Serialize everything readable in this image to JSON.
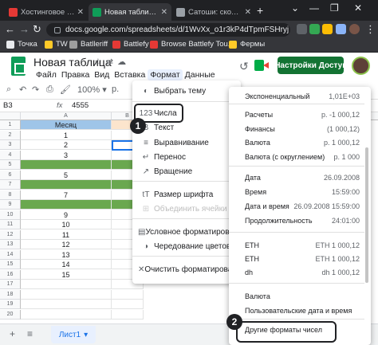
{
  "browser": {
    "tabs": [
      {
        "title": "Хостинговое сообщество",
        "favicon_color": "#e53935"
      },
      {
        "title": "Новая таблица - Google Таблицы",
        "favicon_color": "#0f9d58"
      },
      {
        "title": "Сатоши: сколько Сатоши",
        "favicon_color": "#9aa0a6"
      }
    ],
    "url": "docs.google.com/spreadsheets/d/1WvXx_o1r3kP4dTpmFSHryj",
    "bookmarks": [
      {
        "label": "Точка",
        "color": "#e8eaed"
      },
      {
        "label": "TW",
        "color": "#ffca28"
      },
      {
        "label": "Batlleriff",
        "color": "#9e9e9e"
      },
      {
        "label": "Battlefy",
        "color": "#e53935"
      },
      {
        "label": "Browse Battlefy Tou...",
        "color": "#e53935"
      },
      {
        "label": "Фермы",
        "color": "#ffca28"
      }
    ]
  },
  "sheet": {
    "title": "Новая таблица",
    "menu": [
      "Файл",
      "Правка",
      "Вид",
      "Вставка",
      "Формат",
      "Данные"
    ],
    "share_label": "Настройки Доступа",
    "cell_ref": "B3",
    "fx": "fx",
    "formula_value": "4555",
    "columns": [
      "A",
      "B"
    ],
    "header_cell": "Месяц",
    "rows": [
      {
        "num": "1",
        "a": "Месяц",
        "style": "hdr"
      },
      {
        "num": "2",
        "a": "1",
        "style": ""
      },
      {
        "num": "3",
        "a": "2",
        "style": ""
      },
      {
        "num": "4",
        "a": "3",
        "style": ""
      },
      {
        "num": "5",
        "a": "",
        "style": "green"
      },
      {
        "num": "6",
        "a": "5",
        "style": ""
      },
      {
        "num": "7",
        "a": "",
        "style": "green"
      },
      {
        "num": "8",
        "a": "7",
        "style": ""
      },
      {
        "num": "9",
        "a": "",
        "style": "green"
      },
      {
        "num": "10",
        "a": "9",
        "style": ""
      },
      {
        "num": "11",
        "a": "10",
        "style": ""
      },
      {
        "num": "12",
        "a": "11",
        "style": ""
      },
      {
        "num": "13",
        "a": "12",
        "style": ""
      },
      {
        "num": "14",
        "a": "13",
        "style": ""
      },
      {
        "num": "15",
        "a": "14",
        "style": ""
      },
      {
        "num": "16",
        "a": "15",
        "style": ""
      },
      {
        "num": "17",
        "a": "",
        "style": ""
      },
      {
        "num": "18",
        "a": "",
        "style": ""
      },
      {
        "num": "19",
        "a": "",
        "style": ""
      },
      {
        "num": "20",
        "a": "",
        "style": ""
      }
    ],
    "sheet_tab": "Лист1"
  },
  "format_menu": {
    "items": [
      {
        "label": "Выбрать тему",
        "icon": "◐",
        "disabled": false
      },
      {
        "label": "Числа",
        "icon": "123",
        "disabled": false
      },
      {
        "label": "Текст",
        "icon": "B",
        "disabled": false
      },
      {
        "label": "Выравнивание",
        "icon": "≡",
        "disabled": false
      },
      {
        "label": "Перенос",
        "icon": "↵",
        "disabled": false
      },
      {
        "label": "Вращение",
        "icon": "↗",
        "disabled": false
      },
      {
        "label": "Размер шрифта",
        "icon": "tT",
        "disabled": false
      },
      {
        "label": "Объединить ячейки",
        "icon": "⊞",
        "disabled": true
      },
      {
        "label": "Условное форматирование",
        "icon": "▤",
        "disabled": false
      },
      {
        "label": "Чередование цветов",
        "icon": "◑",
        "disabled": false
      },
      {
        "label": "Очистить форматирование",
        "icon": "✕",
        "disabled": false
      }
    ]
  },
  "number_menu": {
    "items": [
      {
        "label": "Экспоненциальный",
        "value": "1,01E+03"
      },
      {
        "label": "Расчеты",
        "value": "р. -1 000,12"
      },
      {
        "label": "Финансы",
        "value": "(1 000,12)"
      },
      {
        "label": "Валюта",
        "value": "р. 1 000,12"
      },
      {
        "label": "Валюта (с округлением)",
        "value": "р. 1 000"
      },
      {
        "label": "Дата",
        "value": "26.09.2008"
      },
      {
        "label": "Время",
        "value": "15:59:00"
      },
      {
        "label": "Дата и время",
        "value": "26.09.2008 15:59:00"
      },
      {
        "label": "Продолжительность",
        "value": "24:01:00"
      },
      {
        "label": "ETH",
        "value": "ETH 1 000,12"
      },
      {
        "label": "ETH",
        "value": "ETH 1 000,12"
      },
      {
        "label": "dh",
        "value": "dh 1 000,12"
      },
      {
        "label": "Валюта",
        "value": ""
      },
      {
        "label": "Пользовательские дата и время",
        "value": ""
      },
      {
        "label": "Другие форматы чисел",
        "value": ""
      }
    ]
  },
  "steps": {
    "one": "1",
    "two": "2"
  }
}
